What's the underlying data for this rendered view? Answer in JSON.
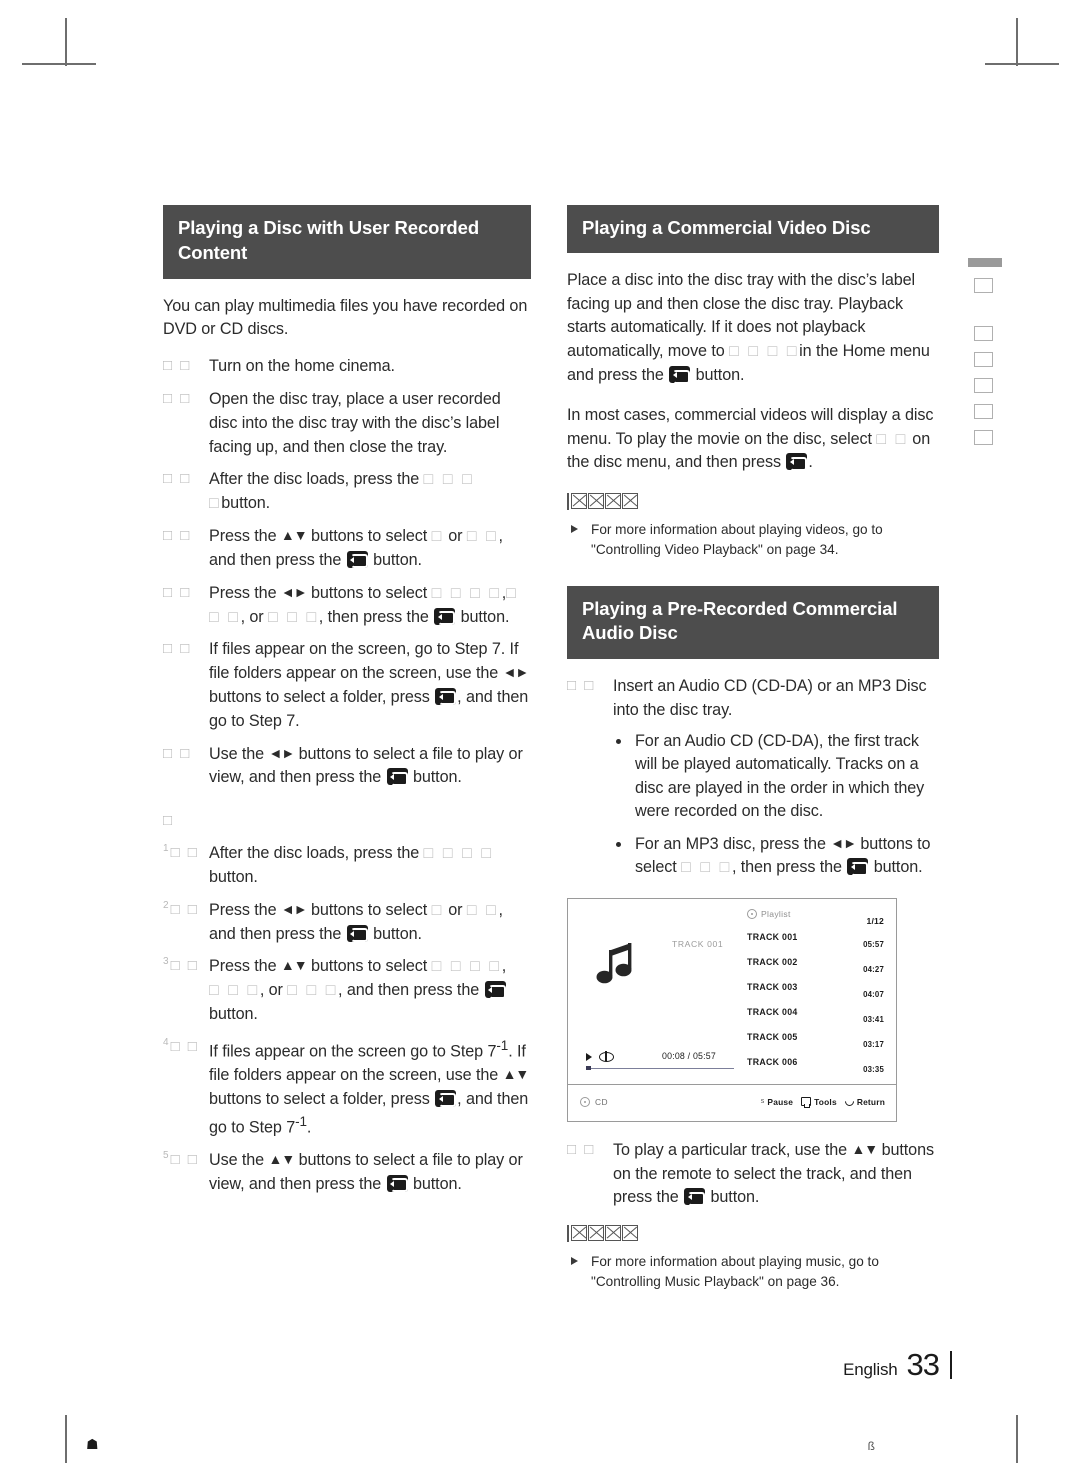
{
  "footer": {
    "language": "English",
    "page_number": "33",
    "left_artifact": "☗",
    "right_artifact": "ß"
  },
  "left_column": {
    "heading": "Playing a Disc with User Recorded Content",
    "intro": "You can play multimedia files you have recorded on DVD or CD discs.",
    "steps": [
      {
        "marker": "□ □",
        "text": "Turn on the home cinema."
      },
      {
        "marker": "□ □",
        "text": "Open the disc tray, place a user recorded disc into the disc tray with the disc’s label facing up, and then close the tray."
      },
      {
        "marker": "□ □",
        "text_before": "After the disc loads,  press the ",
        "tofu1": "□ □ □ □",
        "text_after": "button."
      },
      {
        "marker": "□ □",
        "text_before": "Press the ",
        "arrows": "▲▼",
        "text_mid": " buttons to select ",
        "tofu1": "□",
        "text_mid2": " or ",
        "tofu2": "□ □",
        "text_after": ", and then press the ",
        "text_end": " button."
      },
      {
        "marker": "□ □",
        "text_before": "Press the ",
        "arrows": "◄►",
        "text_mid": " buttons to select ",
        "tofu1": "□ □ □ □",
        "text_mid2": "□ □ □",
        "text_after": ", or ",
        "tofu2": "□ □ □",
        "text_end2": ", then press the ",
        "text_end": " button."
      },
      {
        "marker": "□ □",
        "text_before": "If files appear on the screen, go to Step 7. If file folders appear on the screen, use the ",
        "arrows": "◄►",
        "text_mid": " buttons to select a folder, press ",
        "text_end": ", and then go to Step 7."
      },
      {
        "marker": "□ □",
        "text_before": "Use the ",
        "arrows": "◄►",
        "text_mid": " buttons to select a file to play or view, and then press the ",
        "text_end": " button."
      }
    ],
    "subhead_tofu": "□",
    "steps2": [
      {
        "marker_sup": "1",
        "marker": "□ □",
        "text_before": "After the disc loads, press the ",
        "tofu1": "□ □ □ □",
        "text_after": "button."
      },
      {
        "marker_sup": "2",
        "marker": "□ □",
        "text_before": "Press the ",
        "arrows": "◄►",
        "text_mid": " buttons to select ",
        "tofu1": "□",
        "text_mid2": " or ",
        "tofu2": "□ □",
        "text_after": ", and then press the ",
        "text_end": " button."
      },
      {
        "marker_sup": "3",
        "marker": "□ □",
        "text_before": "Press the ",
        "arrows": "▲▼",
        "text_mid": " buttons to select ",
        "tofu1": "□ □ □ □",
        "text_mid2": "□ □ □",
        "text_after": ", or ",
        "tofu2": "□ □ □",
        "text_end2": ", and then press the ",
        "text_end": " button."
      },
      {
        "marker_sup": "4",
        "marker": "□ □",
        "text_before": "If files appear on the screen go to Step 7",
        "sup1": "-1",
        "text_mid": ". If file folders appear on the screen, use the ",
        "arrows": "▲▼",
        "text_mid2": " buttons to select a folder, press ",
        "text_end": ", and then go to Step 7",
        "sup2": "-1",
        "text_final": "."
      },
      {
        "marker_sup": "5",
        "marker": "□ □",
        "text_before": "Use the ",
        "arrows": "▲▼",
        "text_mid": " buttons to select a file to play or view, and then press the ",
        "text_end": " button."
      }
    ]
  },
  "right_column": {
    "heading_video": "Playing a Commercial Video Disc",
    "video_para1_a": "Place a disc into the disc tray with the disc’s label facing up and then close the disc tray. Playback starts automatically. If it does not playback automatically, move to ",
    "video_para1_tofu": "□ □ □ □",
    "video_para1_b": "in the Home menu and press the ",
    "video_para1_c": " button.",
    "video_para2_a": "In most cases, commercial videos will display a disc menu. To play the movie on the disc, select ",
    "video_para2_tofu": "□ □",
    "video_para2_b": " on the disc menu, and then press ",
    "video_para2_c": ".",
    "note1": "For more information about playing videos, go to \"Controlling Video Playback\" on page 34.",
    "heading_audio": "Playing a Pre-Recorded Commercial Audio Disc",
    "audio_step1_marker": "□ □",
    "audio_step1": "Insert an Audio CD (CD-DA) or an MP3 Disc into the disc tray.",
    "audio_subdots": [
      {
        "text": "For an Audio CD (CD-DA), the first track will be played automatically. Tracks on a disc are played in the order in which they were recorded on the disc."
      }
    ],
    "audio_subdot2_a": "For an MP3 disc, press the ",
    "audio_subdot2_arrows": "◄►",
    "audio_subdot2_b": " buttons to select ",
    "audio_subdot2_tofu": "□ □ □",
    "audio_subdot2_c": ", then press the ",
    "audio_subdot2_d": " button.",
    "audio_step2_marker": "□ □",
    "audio_step2_a": "To play a particular track, use the ",
    "audio_step2_arrows": "▲▼",
    "audio_step2_b": " buttons on the remote to select the track, and then press the ",
    "audio_step2_c": " button.",
    "note2": "For more information about playing music, go to \"Controlling Music Playback\" on page 36."
  },
  "player_screenshot": {
    "now_playing_title": "TRACK 001",
    "playlist_label": "Playlist",
    "page_indicator": "1/12",
    "elapsed_total": "00:08 / 05:57",
    "tracks": [
      {
        "name": "TRACK 001",
        "time": "05:57"
      },
      {
        "name": "TRACK 002",
        "time": "04:27"
      },
      {
        "name": "TRACK 003",
        "time": "04:07"
      },
      {
        "name": "TRACK 004",
        "time": "03:41"
      },
      {
        "name": "TRACK 005",
        "time": "03:17"
      },
      {
        "name": "TRACK 006",
        "time": "03:35"
      }
    ],
    "source_label": "CD",
    "footer_keys": {
      "mini": "s",
      "pause": "Pause",
      "tools": "Tools",
      "return": "Return"
    }
  },
  "colors": {
    "heading_bar": "#4d4d4d",
    "body_text": "#2b2b2b",
    "tofu": "#c2c2c2",
    "progress": "#7c7f9a"
  }
}
